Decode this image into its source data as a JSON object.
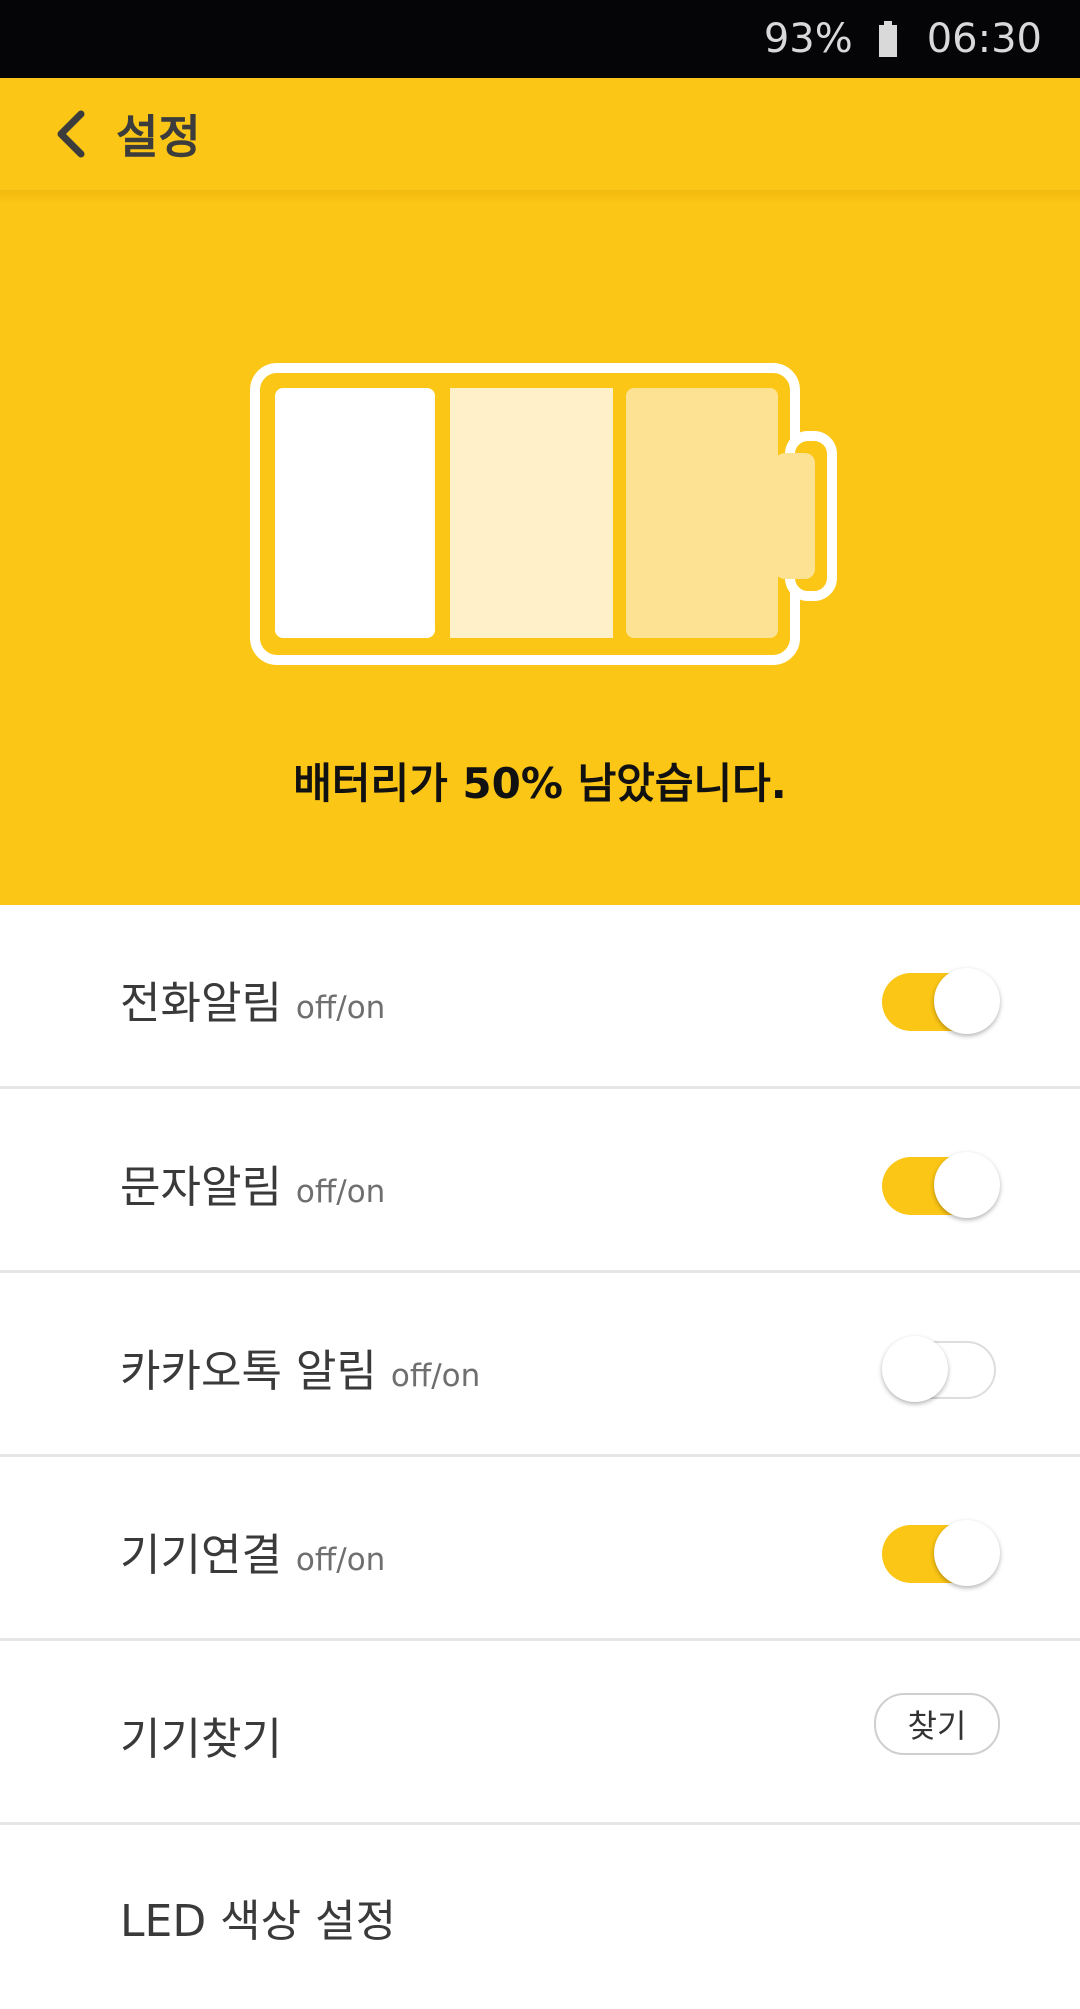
{
  "status_bar": {
    "battery_percent": "93%",
    "time": "06:30"
  },
  "header": {
    "back_icon": "chevron-left-icon",
    "title": "설정"
  },
  "battery": {
    "message": "배터리가 50% 남았습니다.",
    "level_fraction": 0.5,
    "colors": {
      "background": "#fbc615",
      "segment_full": "#ffffff",
      "segment_mid": "#fff0c9",
      "segment_low": "#fde293"
    }
  },
  "settings": [
    {
      "label": "전화알림",
      "sub": "off/on",
      "control": "toggle",
      "on": true
    },
    {
      "label": "문자알림",
      "sub": "off/on",
      "control": "toggle",
      "on": true
    },
    {
      "label": "카카오톡 알림",
      "sub": "off/on",
      "control": "toggle",
      "on": false
    },
    {
      "label": "기기연결",
      "sub": "off/on",
      "control": "toggle",
      "on": true
    },
    {
      "label": "기기찾기",
      "control": "button",
      "button_label": "찾기"
    },
    {
      "label": "LED 색상 설정"
    }
  ],
  "colors": {
    "accent": "#fbc615",
    "status_bar": "#050508"
  }
}
